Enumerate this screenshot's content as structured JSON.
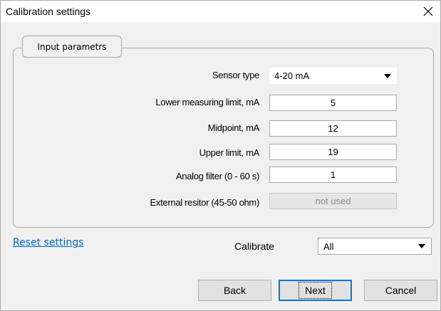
{
  "window": {
    "title": "Calibration settings"
  },
  "group": {
    "legend": "Input parametrs",
    "rows": [
      {
        "label": "Sensor type",
        "value": "4-20 mA"
      },
      {
        "label": "Lower measuring limit, mA",
        "value": "5"
      },
      {
        "label": "Midpoint, mA",
        "value": "12"
      },
      {
        "label": "Upper limit, mA",
        "value": "19"
      },
      {
        "label": "Analog filter (0 - 60 s)",
        "value": "1"
      },
      {
        "label": "External resitor (45-50 ohm)",
        "value": "not used"
      }
    ]
  },
  "reset_link": "Reset settings",
  "calibrate": {
    "label": "Calibrate",
    "value": "All"
  },
  "buttons": {
    "back": "Back",
    "next": "Next",
    "cancel": "Cancel"
  }
}
